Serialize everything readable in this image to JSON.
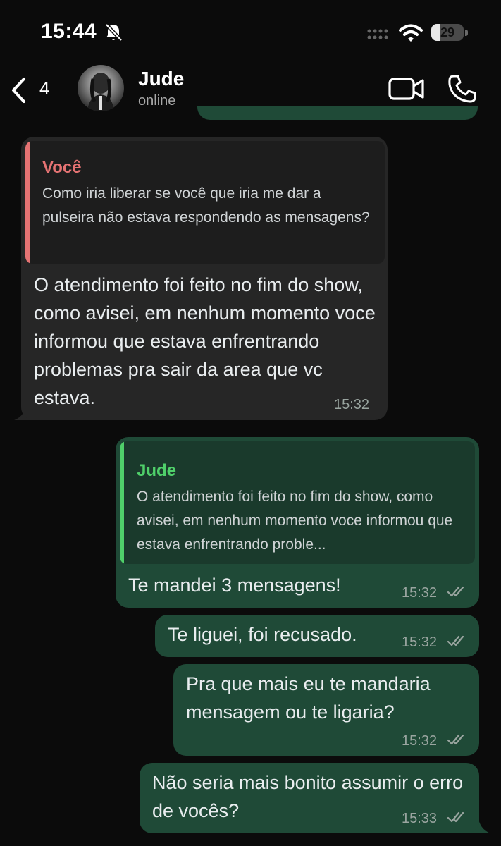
{
  "status_bar": {
    "time": "15:44",
    "battery_level": "29",
    "battery_fraction": 0.29
  },
  "header": {
    "back_count": "4",
    "name": "Jude",
    "status": "online"
  },
  "messages": [
    {
      "direction": "in",
      "quote": {
        "name": "Você",
        "text": "Como iria liberar se você que iria me dar a pulseira não estava respondendo as mensagens?"
      },
      "text": "O atendimento foi feito no fim do show, como avisei, em nenhum momento voce informou que estava enfrentrando problemas pra sair da area que vc estava.",
      "time": "15:32"
    },
    {
      "direction": "out",
      "quote": {
        "name": "Jude",
        "text": "O atendimento foi feito no fim do show, como avisei, em nenhum momento voce informou que estava enfrentrando proble..."
      },
      "text": "Te mandei 3 mensagens!",
      "time": "15:32"
    },
    {
      "direction": "out",
      "text": "Te liguei, foi recusado.",
      "time": "15:32"
    },
    {
      "direction": "out",
      "text": "Pra que mais eu te mandaria mensagem ou te ligaria?",
      "time": "15:32"
    },
    {
      "direction": "out",
      "text": "Não seria mais bonito assumir o erro de vocês?",
      "time": "15:33"
    }
  ],
  "colors": {
    "incoming_bubble": "#262626",
    "outgoing_bubble": "#1f4a37",
    "quote_you_accent": "#e57373",
    "quote_contact_accent": "#4fd06a"
  },
  "icons": [
    "bell-slash-icon",
    "signal-icon",
    "wifi-icon",
    "battery-icon",
    "chevron-left-icon",
    "video-camera-icon",
    "phone-icon",
    "double-check-icon"
  ]
}
